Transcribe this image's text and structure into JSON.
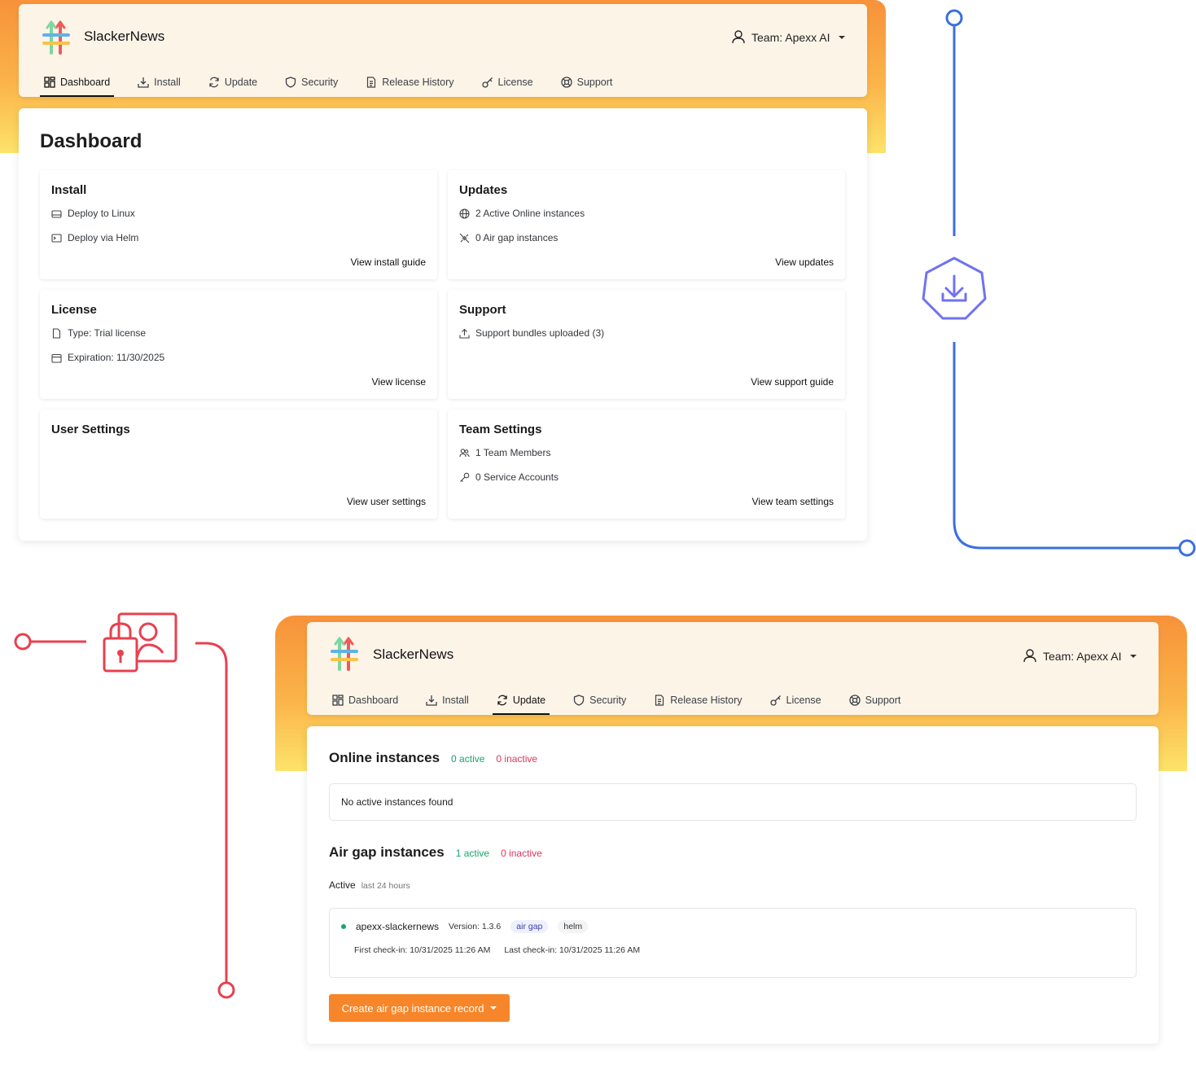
{
  "brand": "SlackerNews",
  "team_label": "Team: Apexx AI",
  "nav": [
    {
      "label": "Dashboard",
      "icon": "dashboard-icon"
    },
    {
      "label": "Install",
      "icon": "download-icon"
    },
    {
      "label": "Update",
      "icon": "refresh-icon"
    },
    {
      "label": "Security",
      "icon": "shield-icon"
    },
    {
      "label": "Release History",
      "icon": "document-icon"
    },
    {
      "label": "License",
      "icon": "key-icon"
    },
    {
      "label": "Support",
      "icon": "lifebuoy-icon"
    }
  ],
  "dashboard": {
    "title": "Dashboard",
    "active_tab": "Dashboard",
    "cards": {
      "install": {
        "title": "Install",
        "lines": [
          "Deploy to Linux",
          "Deploy via Helm"
        ],
        "link": "View install guide"
      },
      "updates": {
        "title": "Updates",
        "lines": [
          "2 Active Online instances",
          "0 Air gap instances"
        ],
        "link": "View updates"
      },
      "license": {
        "title": "License",
        "lines": [
          "Type: Trial license",
          "Expiration: 11/30/2025"
        ],
        "link": "View license"
      },
      "support": {
        "title": "Support",
        "lines": [
          "Support bundles uploaded (3)"
        ],
        "link": "View support guide"
      },
      "user_settings": {
        "title": "User Settings",
        "lines": [],
        "link": "View user settings"
      },
      "team_settings": {
        "title": "Team Settings",
        "lines": [
          "1 Team Members",
          "0 Service Accounts"
        ],
        "link": "View team settings"
      }
    }
  },
  "update_page": {
    "active_tab": "Update",
    "online": {
      "title": "Online instances",
      "active": "0 active",
      "inactive": "0 inactive",
      "empty": "No active instances found"
    },
    "airgap": {
      "title": "Air gap instances",
      "active": "1 active",
      "inactive": "0 inactive",
      "filter_label": "Active",
      "filter_hint": "last 24 hours",
      "instance": {
        "name": "apexx-slackernews",
        "version": "Version: 1.3.6",
        "tags": [
          "air gap",
          "helm"
        ],
        "first_checkin": "First check-in: 10/31/2025 11:26 AM",
        "last_checkin": "Last check-in: 10/31/2025 11:26 AM",
        "status_color": "#18a56b"
      }
    },
    "create_button": "Create air gap instance record"
  },
  "colors": {
    "accent_orange": "#f7862a",
    "connector_blue": "#3b6fe0",
    "connector_red": "#e8404f",
    "hex_icon": "#6f73f0"
  },
  "decor_icons": [
    "download-hex-icon",
    "lock-user-icon"
  ]
}
